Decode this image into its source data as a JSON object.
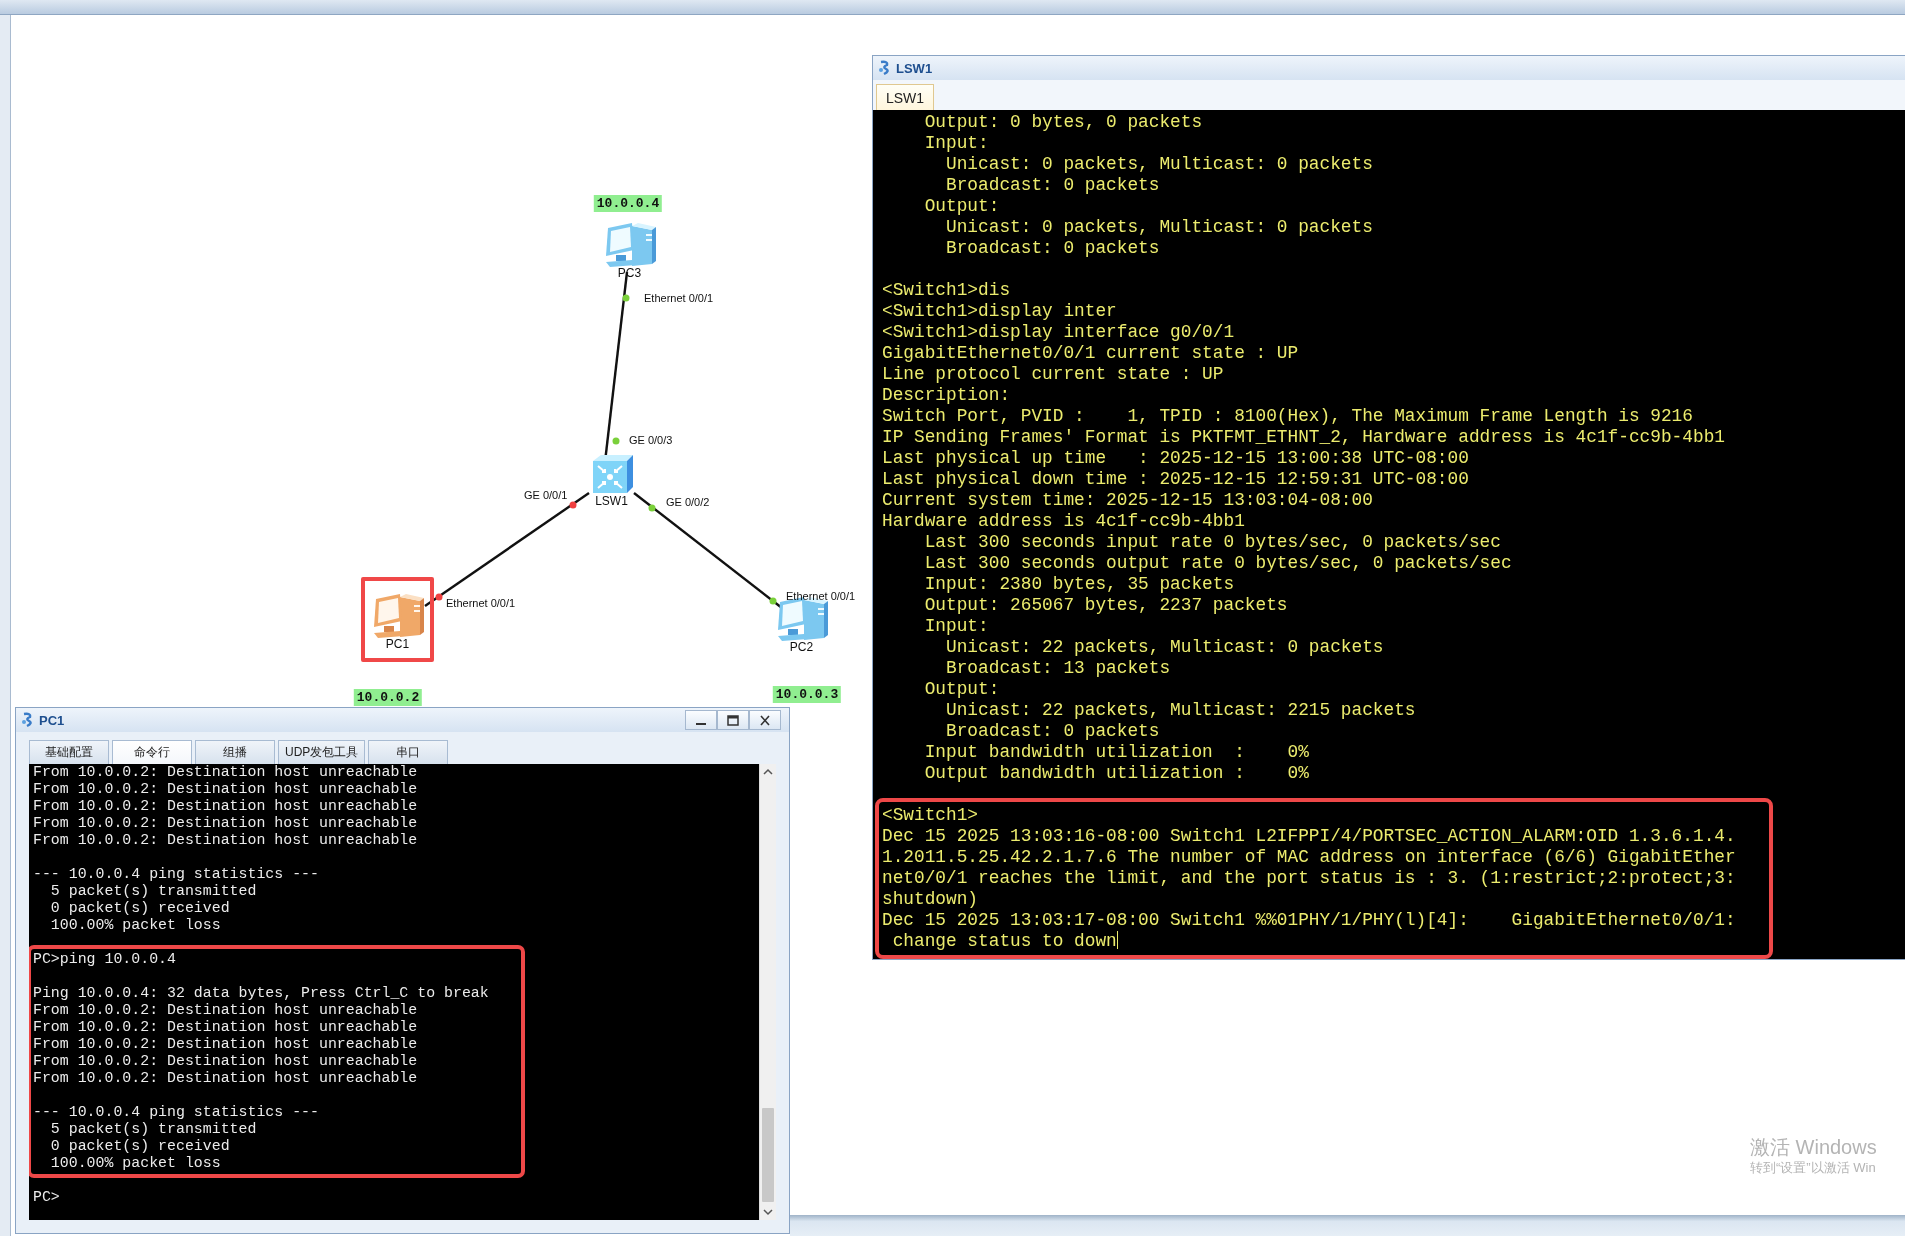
{
  "topology": {
    "nodes": [
      {
        "kind": "pc",
        "name": "PC3",
        "ip": "10.0.0.4",
        "selected": false
      },
      {
        "kind": "switch",
        "name": "LSW1",
        "selected": false
      },
      {
        "kind": "pc",
        "name": "PC1",
        "ip": "10.0.0.2",
        "selected": true
      },
      {
        "kind": "pc",
        "name": "PC2",
        "ip": "10.0.0.3",
        "selected": false
      }
    ],
    "links": [
      {
        "ends": [
          {
            "port": "Ethernet 0/0/1",
            "up": true
          },
          {
            "port": "GE 0/0/3",
            "up": true
          }
        ]
      },
      {
        "ends": [
          {
            "port": "GE 0/0/1",
            "up": false
          },
          {
            "port": "Ethernet 0/0/1",
            "up": false
          }
        ]
      },
      {
        "ends": [
          {
            "port": "GE 0/0/2",
            "up": true
          },
          {
            "port": "Ethernet 0/0/1",
            "up": true
          }
        ]
      }
    ]
  },
  "lsw1_window": {
    "title": "LSW1",
    "tabs": [
      {
        "label": "LSW1",
        "selected": true
      }
    ],
    "cursor": true,
    "segments": [
      {
        "highlighted": false,
        "paragraphs": [
          [
            "    Output: 0 bytes, 0 packets",
            "    Input:",
            "      Unicast: 0 packets, Multicast: 0 packets",
            "      Broadcast: 0 packets",
            "    Output:",
            "      Unicast: 0 packets, Multicast: 0 packets",
            "      Broadcast: 0 packets"
          ],
          [
            "<Switch1>dis",
            "<Switch1>display inter",
            "<Switch1>display interface g0/0/1",
            "GigabitEthernet0/0/1 current state : UP",
            "Line protocol current state : UP",
            "Description:",
            "Switch Port, PVID :    1, TPID : 8100(Hex), The Maximum Frame Length is 9216",
            "IP Sending Frames' Format is PKTFMT_ETHNT_2, Hardware address is 4c1f-cc9b-4bb1",
            "Last physical up time   : 2025-12-15 13:00:38 UTC-08:00",
            "Last physical down time : 2025-12-15 12:59:31 UTC-08:00",
            "Current system time: 2025-12-15 13:03:04-08:00",
            "Hardware address is 4c1f-cc9b-4bb1",
            "    Last 300 seconds input rate 0 bytes/sec, 0 packets/sec",
            "    Last 300 seconds output rate 0 bytes/sec, 0 packets/sec",
            "    Input: 2380 bytes, 35 packets",
            "    Output: 265067 bytes, 2237 packets",
            "    Input:",
            "      Unicast: 22 packets, Multicast: 0 packets",
            "      Broadcast: 13 packets",
            "    Output:",
            "      Unicast: 22 packets, Multicast: 2215 packets",
            "      Broadcast: 0 packets",
            "    Input bandwidth utilization  :    0%",
            "    Output bandwidth utilization :    0%"
          ]
        ]
      },
      {
        "highlighted": true,
        "paragraphs": [
          [
            "<Switch1>",
            "Dec 15 2025 13:03:16-08:00 Switch1 L2IFPPI/4/PORTSEC_ACTION_ALARM:OID 1.3.6.1.4.",
            "1.2011.5.25.42.2.1.7.6 The number of MAC address on interface (6/6) GigabitEther",
            "net0/0/1 reaches the limit, and the port status is : 3. (1:restrict;2:protect;3:",
            "shutdown)",
            "Dec 15 2025 13:03:17-08:00 Switch1 %%01PHY/1/PHY(l)[4]:    GigabitEthernet0/0/1:",
            " change status to down"
          ]
        ]
      }
    ]
  },
  "pc1_window": {
    "title": "PC1",
    "buttons": [
      {
        "kind": "minimize"
      },
      {
        "kind": "maximize"
      },
      {
        "kind": "close"
      }
    ],
    "tabs": [
      {
        "label": "基础配置",
        "selected": false
      },
      {
        "label": "命令行",
        "selected": true
      },
      {
        "label": "组播",
        "selected": false
      },
      {
        "label": "UDP发包工具",
        "selected": false
      },
      {
        "label": "串口",
        "selected": false
      }
    ],
    "segments": [
      {
        "highlighted": false,
        "paragraphs": [
          [
            "From 10.0.0.2: Destination host unreachable",
            "From 10.0.0.2: Destination host unreachable",
            "From 10.0.0.2: Destination host unreachable",
            "From 10.0.0.2: Destination host unreachable",
            "From 10.0.0.2: Destination host unreachable"
          ],
          [
            "--- 10.0.0.4 ping statistics ---",
            "  5 packet(s) transmitted",
            "  0 packet(s) received",
            "  100.00% packet loss"
          ]
        ]
      },
      {
        "highlighted": true,
        "paragraphs": [
          [
            "PC>ping 10.0.0.4"
          ],
          [
            "Ping 10.0.0.4: 32 data bytes, Press Ctrl_C to break",
            "From 10.0.0.2: Destination host unreachable",
            "From 10.0.0.2: Destination host unreachable",
            "From 10.0.0.2: Destination host unreachable",
            "From 10.0.0.2: Destination host unreachable",
            "From 10.0.0.2: Destination host unreachable"
          ],
          [
            "--- 10.0.0.4 ping statistics ---",
            "  5 packet(s) transmitted",
            "  0 packet(s) received",
            "  100.00% packet loss"
          ]
        ]
      },
      {
        "highlighted": false,
        "paragraphs": [
          [
            "PC>"
          ]
        ]
      }
    ]
  },
  "activation_notice": {
    "title": "激活 Windows",
    "subtitle": "转到“设置”以激活 Win"
  }
}
